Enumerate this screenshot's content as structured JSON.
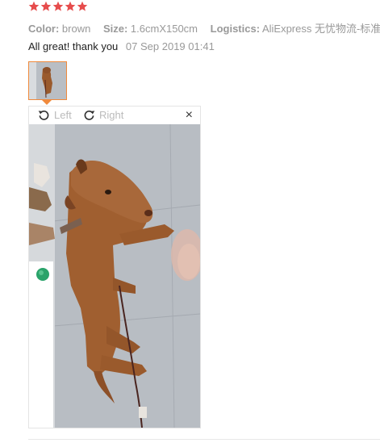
{
  "rating": {
    "stars": 5,
    "filled": 5,
    "color": "#e64c4c"
  },
  "attributes": [
    {
      "label": "Color:",
      "value": "brown"
    },
    {
      "label": "Size:",
      "value": "1.6cmX150cm"
    },
    {
      "label": "Logistics:",
      "value": "AliExpress 无忧物流-标准"
    }
  ],
  "review": {
    "text": "All great! thank you",
    "date": "07 Sep 2019 01:41"
  },
  "viewer": {
    "rotate_left_label": "Left",
    "rotate_right_label": "Right",
    "close_label": "×",
    "accent_color": "#f08a3c"
  }
}
